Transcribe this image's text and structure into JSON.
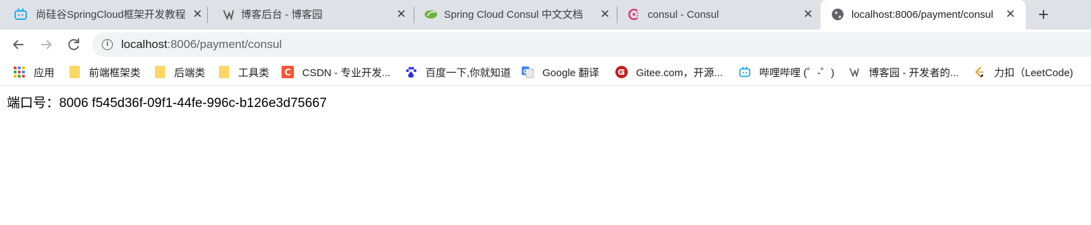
{
  "tabs": [
    {
      "title": "尚硅谷SpringCloud框架开发教程",
      "icon": "bilibili-icon"
    },
    {
      "title": "博客后台 - 博客园",
      "icon": "cnblogs-icon"
    },
    {
      "title": "Spring Cloud Consul 中文文档",
      "icon": "spring-icon"
    },
    {
      "title": "consul - Consul",
      "icon": "consul-icon"
    },
    {
      "title": "localhost:8006/payment/consul",
      "icon": "globe-icon"
    }
  ],
  "toolbar": {
    "url_host": "localhost",
    "url_rest": ":8006/payment/consul"
  },
  "bookmarks": [
    {
      "label": "应用",
      "icon": "apps-grid-icon"
    },
    {
      "label": "前端框架类",
      "icon": "folder-icon"
    },
    {
      "label": "后端类",
      "icon": "folder-icon"
    },
    {
      "label": "工具类",
      "icon": "folder-icon"
    },
    {
      "label": "CSDN - 专业开发...",
      "icon": "csdn-icon"
    },
    {
      "label": "百度一下,你就知道",
      "icon": "baidu-icon"
    },
    {
      "label": "Google 翻译",
      "icon": "google-translate-icon"
    },
    {
      "label": "Gitee.com，开源...",
      "icon": "gitee-icon"
    },
    {
      "label": "哔哩哔哩 (゜-゜)",
      "icon": "bilibili-icon"
    },
    {
      "label": "博客园 - 开发者的...",
      "icon": "cnblogs-icon"
    },
    {
      "label": "力扣（LeetCode)",
      "icon": "leetcode-icon"
    }
  ],
  "page": {
    "text": "端口号：8006 f545d36f-09f1-44fe-996c-b126e3d75667"
  },
  "colors": {
    "tabstrip": "#dee1e6",
    "omnibox": "#f1f3f4",
    "folder": "#fdd663"
  }
}
